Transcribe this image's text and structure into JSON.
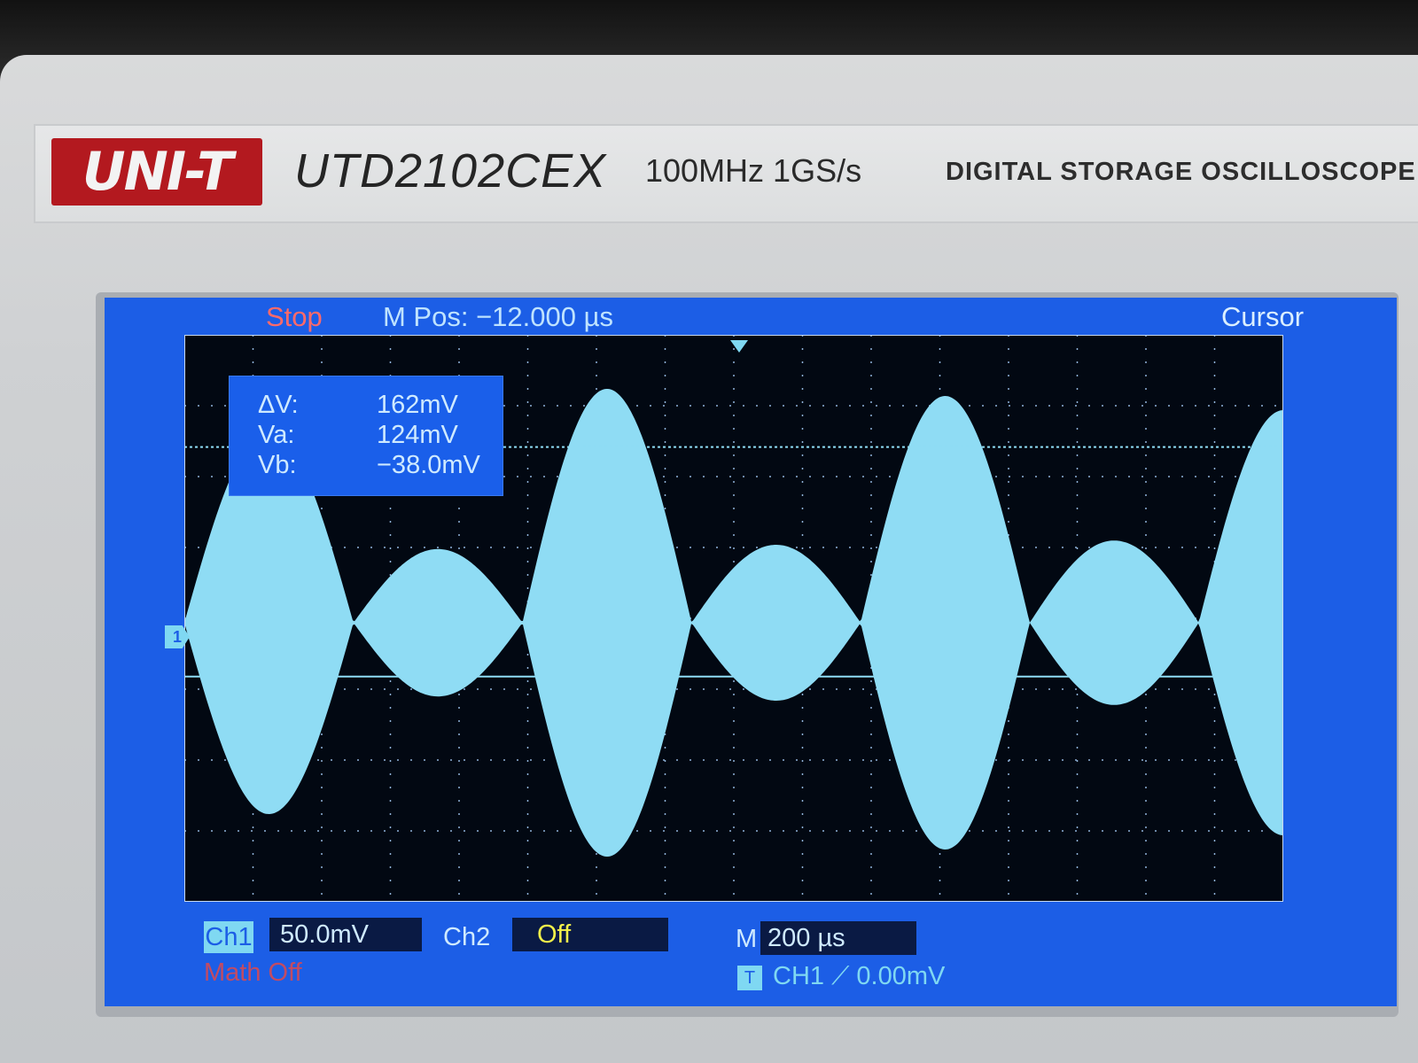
{
  "device": {
    "brand": "UNI-T",
    "model": "UTD2102CEX",
    "spec": "100MHz  1GS/s",
    "description": "DIGITAL STORAGE OSCILLOSCOPE"
  },
  "status": {
    "run_state": "Stop",
    "mpos": "M Pos: −12.000 µs",
    "menu": "Cursor"
  },
  "markers": {
    "channel": "1"
  },
  "measurements": {
    "delta_v_label": "ΔV:",
    "delta_v": "162mV",
    "va_label": "Va:",
    "va": "124mV",
    "vb_label": "Vb:",
    "vb": "−38.0mV"
  },
  "bottom": {
    "ch1_label": "Ch1",
    "ch1_scale": "50.0mV",
    "ch2_label": "Ch2",
    "ch2_state": "Off",
    "time_label": "M",
    "time_scale": "200 µs",
    "math": "Math    Off",
    "trigger_tag": "T",
    "trigger_info": "CH1  ⟋  0.00mV"
  },
  "colors": {
    "screen": "#1c5ee6",
    "waveform": "#8fdcf4",
    "grid_bg": "#020812",
    "stop": "#ff6a6a",
    "off": "#f3f04a"
  },
  "waveform": {
    "description_type": "beat / amplitude-modulated envelope",
    "envelope_peaks_mv": [
      135,
      52,
      165,
      55,
      160,
      58,
      150
    ],
    "cursor_a_mv": 124,
    "cursor_b_mv": -38
  }
}
